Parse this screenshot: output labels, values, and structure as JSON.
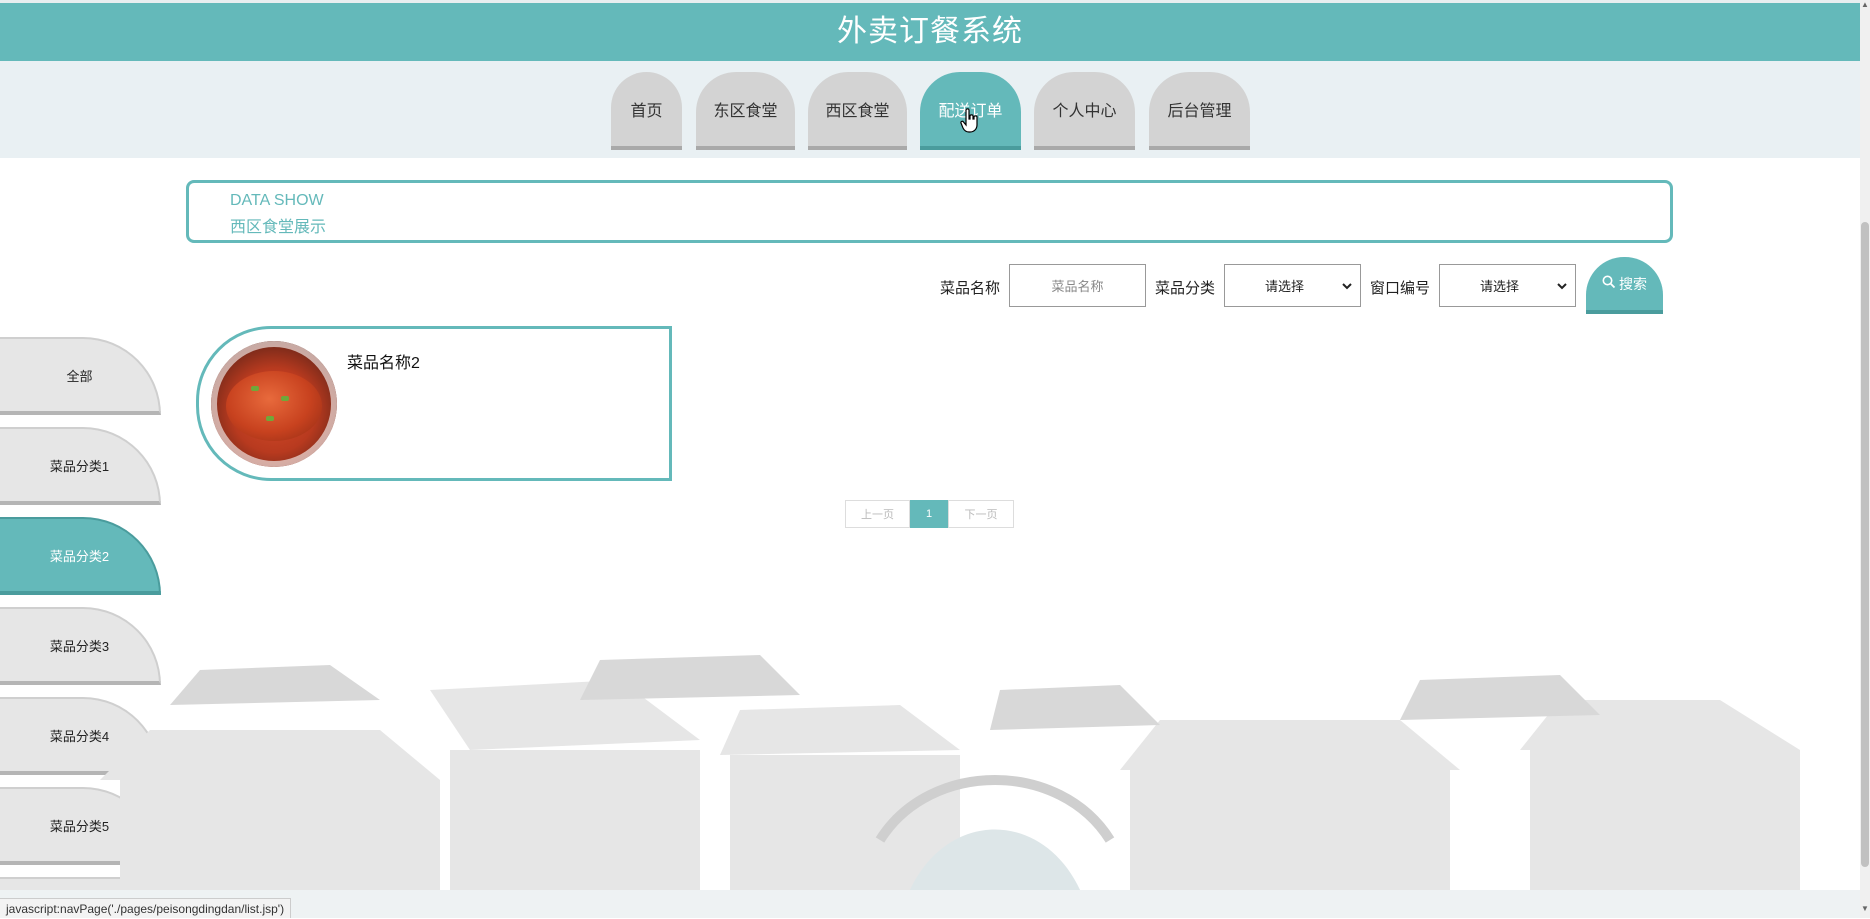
{
  "app": {
    "title": "外卖订餐系统"
  },
  "nav": {
    "items": [
      {
        "label": "首页"
      },
      {
        "label": "东区食堂"
      },
      {
        "label": "西区食堂"
      },
      {
        "label": "配送订单"
      },
      {
        "label": "个人中心"
      },
      {
        "label": "后台管理"
      }
    ],
    "active_index": 3
  },
  "datashow": {
    "line1": "DATA SHOW",
    "line2": "西区食堂展示"
  },
  "search": {
    "name_label": "菜品名称",
    "name_placeholder": "菜品名称",
    "category_label": "菜品分类",
    "category_value": "请选择",
    "window_label": "窗口编号",
    "window_value": "请选择",
    "button_label": "搜索"
  },
  "categories": [
    {
      "label": "全部"
    },
    {
      "label": "菜品分类1"
    },
    {
      "label": "菜品分类2"
    },
    {
      "label": "菜品分类3"
    },
    {
      "label": "菜品分类4"
    },
    {
      "label": "菜品分类5"
    }
  ],
  "active_category_index": 2,
  "products": [
    {
      "name": "菜品名称2"
    }
  ],
  "pagination": {
    "prev": "上一页",
    "current": "1",
    "next": "下一页"
  },
  "status_bar": "javascript:navPage('./pages/peisongdingdan/list.jsp')",
  "colors": {
    "accent": "#64b9ba",
    "tab_inactive": "#d3d3d3",
    "nav_bg": "#e9f0f3"
  },
  "icons": {
    "search": "magnifier-icon",
    "cursor": "hand-pointer-icon",
    "select": "chevron-down-icon"
  }
}
